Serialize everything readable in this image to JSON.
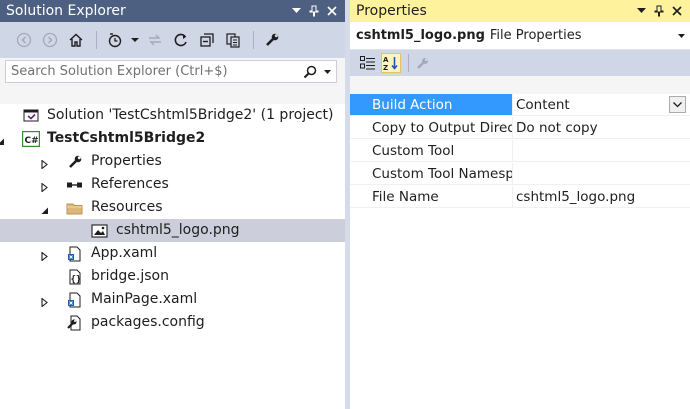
{
  "solution_explorer": {
    "title": "Solution Explorer",
    "search_placeholder": "Search Solution Explorer (Ctrl+$)",
    "tree": [
      {
        "id": "solution",
        "label": "Solution 'TestCshtml5Bridge2' (1 project)",
        "icon": "solution-icon",
        "level": 0,
        "expander": "none",
        "bold": false,
        "selected": false
      },
      {
        "id": "project",
        "label": "TestCshtml5Bridge2",
        "icon": "csharp-project-icon",
        "level": 0,
        "expander": "expanded",
        "bold": true,
        "selected": false
      },
      {
        "id": "properties",
        "label": "Properties",
        "icon": "wrench-icon",
        "level": 1,
        "expander": "collapsed",
        "bold": false,
        "selected": false
      },
      {
        "id": "references",
        "label": "References",
        "icon": "references-icon",
        "level": 1,
        "expander": "collapsed",
        "bold": false,
        "selected": false
      },
      {
        "id": "resources",
        "label": "Resources",
        "icon": "folder-icon",
        "level": 1,
        "expander": "expanded",
        "bold": false,
        "selected": false
      },
      {
        "id": "logo",
        "label": "cshtml5_logo.png",
        "icon": "image-file-icon",
        "level": 2,
        "expander": "none",
        "bold": false,
        "selected": true
      },
      {
        "id": "app",
        "label": "App.xaml",
        "icon": "xaml-file-icon",
        "level": 1,
        "expander": "collapsed",
        "bold": false,
        "selected": false
      },
      {
        "id": "bridge",
        "label": "bridge.json",
        "icon": "json-file-icon",
        "level": 1,
        "expander": "none",
        "bold": false,
        "selected": false
      },
      {
        "id": "mainpage",
        "label": "MainPage.xaml",
        "icon": "xaml-file-icon",
        "level": 1,
        "expander": "collapsed",
        "bold": false,
        "selected": false
      },
      {
        "id": "packages",
        "label": "packages.config",
        "icon": "config-file-icon",
        "level": 1,
        "expander": "none",
        "bold": false,
        "selected": false
      }
    ]
  },
  "properties": {
    "title": "Properties",
    "object_name": "cshtml5_logo.png",
    "object_type": "File Properties",
    "rows": [
      {
        "name": "Build Action",
        "value": "Content",
        "selected": true,
        "has_dropdown": true
      },
      {
        "name": "Copy to Output Directory",
        "value": "Do not copy",
        "selected": false,
        "has_dropdown": false
      },
      {
        "name": "Custom Tool",
        "value": "",
        "selected": false,
        "has_dropdown": false
      },
      {
        "name": "Custom Tool Namespace",
        "value": "",
        "selected": false,
        "has_dropdown": false
      },
      {
        "name": "File Name",
        "value": "cshtml5_logo.png",
        "selected": false,
        "has_dropdown": false
      }
    ]
  },
  "colors": {
    "se_title_bg": "#4D6082",
    "pp_title_bg": "#FFF29D",
    "toolbar_bg": "#CFD6E5",
    "selection_tree": "#CCCEDB",
    "selection_grid": "#3399FF"
  }
}
